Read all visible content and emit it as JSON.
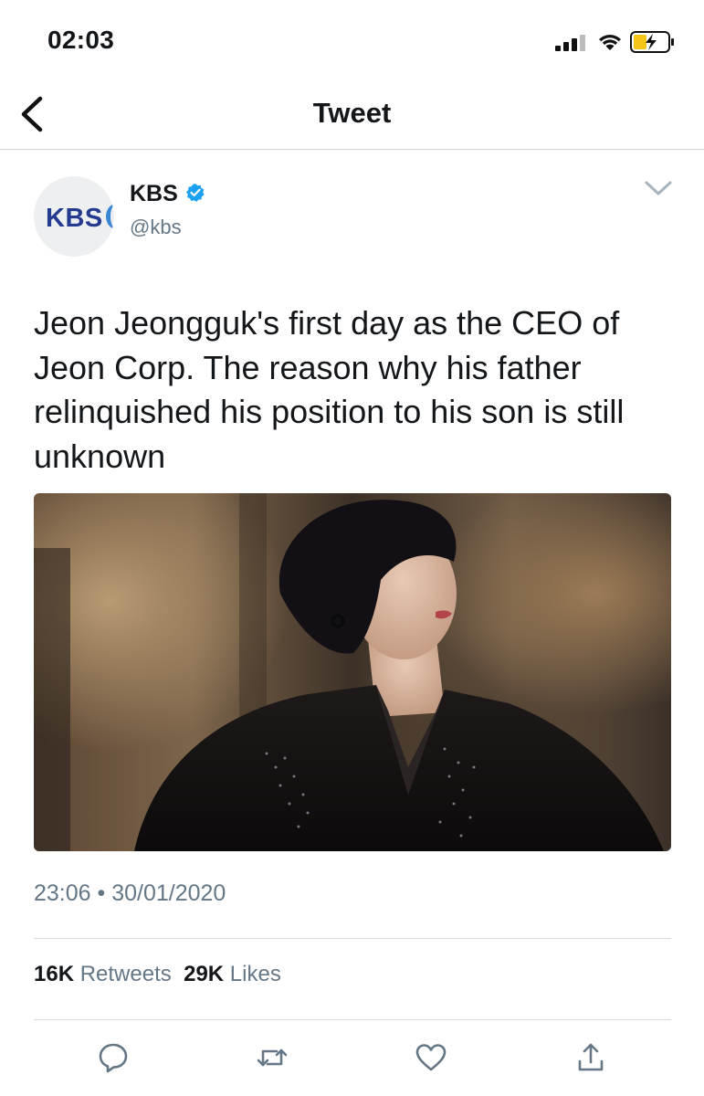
{
  "status_bar": {
    "time": "02:03"
  },
  "nav": {
    "title": "Tweet"
  },
  "tweet": {
    "author": {
      "display_name": "KBS",
      "handle": "@kbs",
      "avatar_text": "KBS",
      "verified": true
    },
    "text": "Jeon Jeongguk's first day as the CEO of Jeon Corp. The reason why his father relinquished his position to his son is still unknown",
    "timestamp": "23:06 • 30/01/2020",
    "stats": {
      "retweets_count": "16K",
      "retweets_label": "Retweets",
      "likes_count": "29K",
      "likes_label": "Likes"
    }
  },
  "colors": {
    "text_primary": "#14171a",
    "text_secondary": "#657786",
    "verified_blue": "#1da1f2",
    "divider": "#d6dbdf",
    "kbs_navy": "#243b8f"
  },
  "icons": {
    "back": "chevron-left-icon",
    "more": "chevron-down-icon",
    "verified": "verified-badge-icon",
    "reply": "comment-icon",
    "retweet": "retweet-icon",
    "like": "heart-icon",
    "share": "share-icon"
  }
}
